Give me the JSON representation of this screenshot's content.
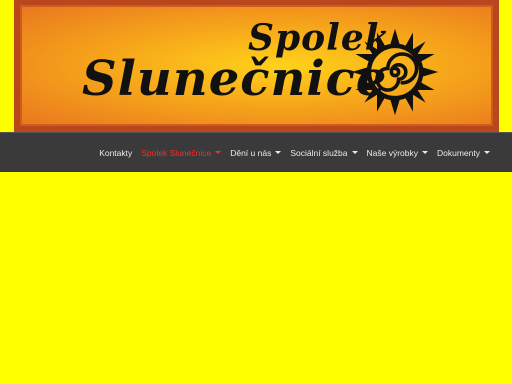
{
  "header": {
    "logo_line1": "Spolek",
    "logo_line2": "Slunečnice",
    "logo_icon": "sun-spiral-icon"
  },
  "nav": {
    "items": [
      {
        "label": "Kontakty",
        "has_dropdown": false,
        "active": false
      },
      {
        "label": "Spolek Slunečnice",
        "has_dropdown": true,
        "active": true
      },
      {
        "label": "Dění u nás",
        "has_dropdown": true,
        "active": false
      },
      {
        "label": "Sociální služba",
        "has_dropdown": true,
        "active": false
      },
      {
        "label": "Naše výrobky",
        "has_dropdown": true,
        "active": false
      },
      {
        "label": "Dokumenty",
        "has_dropdown": true,
        "active": false
      }
    ]
  },
  "colors": {
    "page_background": "#ffff00",
    "navbar_background": "#3a3a3a",
    "active_menu": "#ff2a2a",
    "banner_border": "#b8481c"
  }
}
